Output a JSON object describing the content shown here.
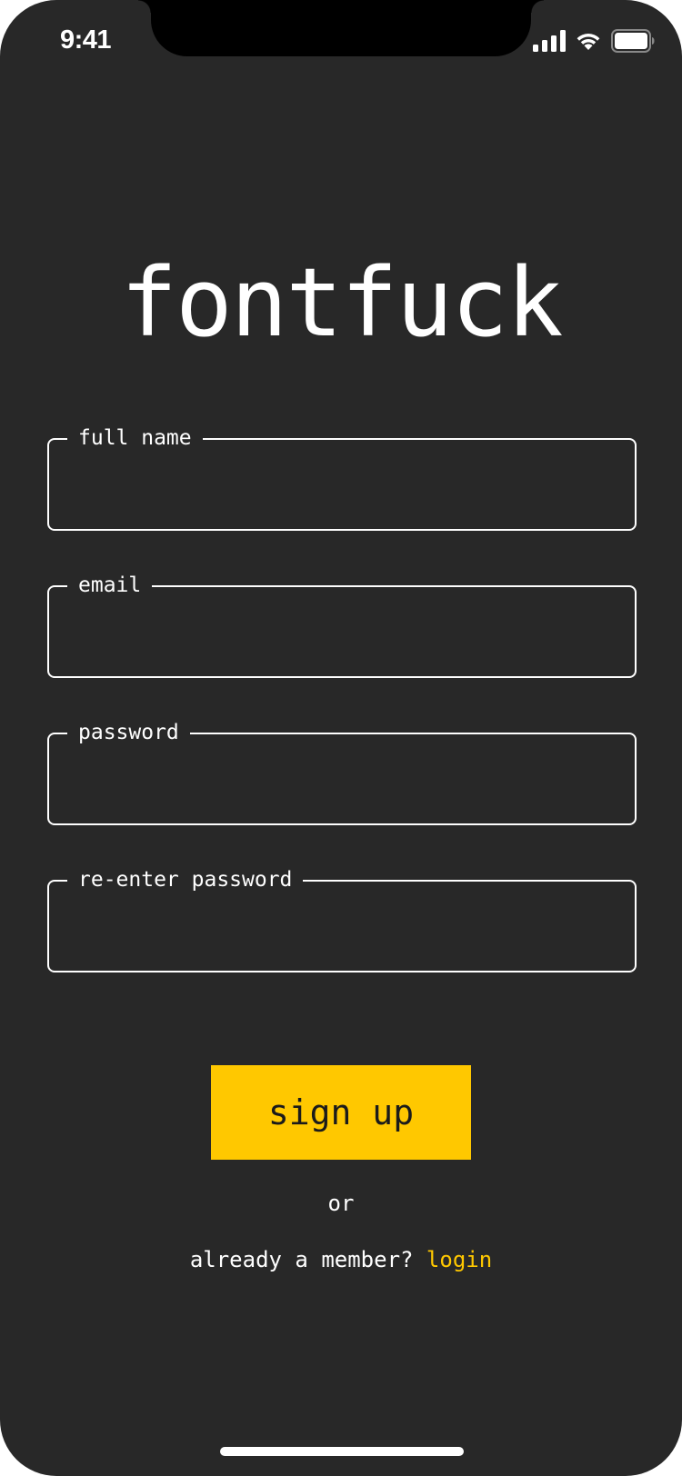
{
  "status_bar": {
    "time": "9:41",
    "signal_icon": "cellular-signal-icon",
    "wifi_icon": "wifi-icon",
    "battery_icon": "battery-full-icon"
  },
  "app": {
    "title": "fontfuck"
  },
  "form": {
    "fields": [
      {
        "label": "full name",
        "value": "",
        "placeholder": ""
      },
      {
        "label": "email",
        "value": "",
        "placeholder": ""
      },
      {
        "label": "password",
        "value": "",
        "placeholder": ""
      },
      {
        "label": "re-enter password",
        "value": "",
        "placeholder": ""
      }
    ],
    "submit_label": "sign up"
  },
  "footer": {
    "or_text": "or",
    "member_prompt": "already a member?",
    "login_label": "login"
  },
  "colors": {
    "background": "#282828",
    "accent": "#ffc800",
    "text": "#ffffff",
    "button_text": "#1b1b1b"
  }
}
